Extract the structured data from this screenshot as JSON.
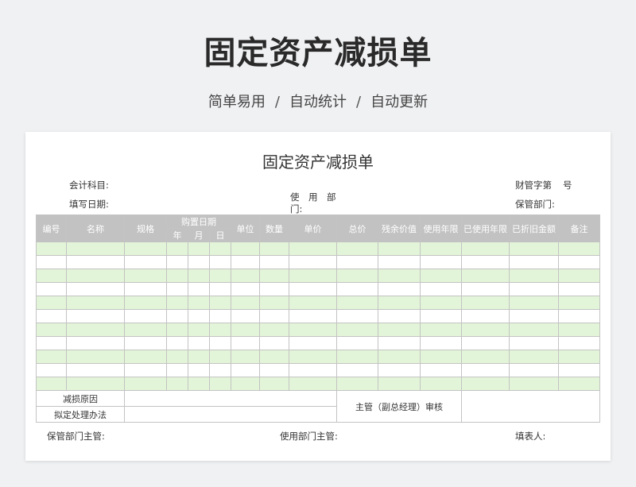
{
  "header": {
    "title": "固定资产减损单",
    "subtitle_items": [
      "简单易用",
      "自动统计",
      "自动更新"
    ],
    "subtitle_sep": "/"
  },
  "form": {
    "title": "固定资产减损单",
    "account_label": "会计科目:",
    "fill_date_label": "填写日期:",
    "dept_label": "使　用　部　门:",
    "finance_label": "财管字第",
    "number_label": "号",
    "custody_label": "保管部门:"
  },
  "table": {
    "headers": {
      "no": "编号",
      "name": "名称",
      "spec": "规格",
      "purchase_date": "购置日期",
      "year": "年",
      "month": "月",
      "day": "日",
      "unit": "单位",
      "qty": "数量",
      "unit_price": "单价",
      "total": "总价",
      "residual": "残余价值",
      "life": "使用年限",
      "used_years": "已使用年限",
      "depreciation": "已折旧金额",
      "remark": "备注"
    },
    "row_count": 11,
    "reason_label": "减损原因",
    "method_label": "拟定处理办法",
    "review_label": "主管（副总经理）审核"
  },
  "footer": {
    "custody_head": "保管部门主管:",
    "dept_head": "使用部门主管:",
    "filler": "填表人:"
  }
}
